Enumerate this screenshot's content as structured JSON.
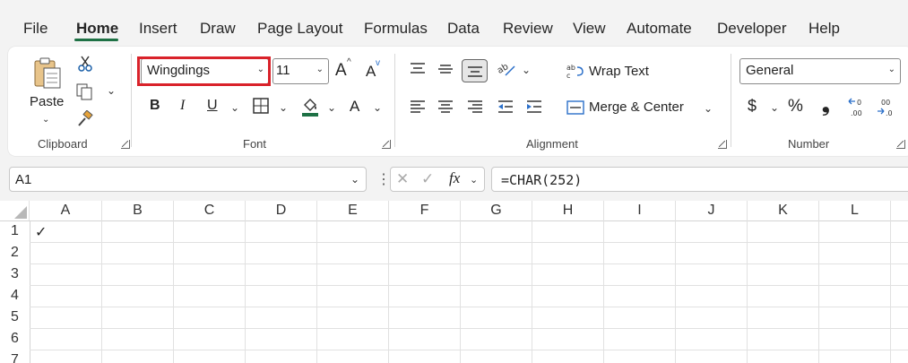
{
  "menu": {
    "tabs": [
      "File",
      "Home",
      "Insert",
      "Draw",
      "Page Layout",
      "Formulas",
      "Data",
      "Review",
      "View",
      "Automate",
      "Developer",
      "Help"
    ],
    "active": "Home"
  },
  "ribbon": {
    "clipboard": {
      "paste_label": "Paste",
      "group_label": "Clipboard"
    },
    "font": {
      "font_name": "Wingdings",
      "font_size": "11",
      "group_label": "Font",
      "grow_label": "A",
      "shrink_label": "A",
      "bold": "B",
      "italic": "I",
      "underline": "U",
      "color_label": "A"
    },
    "alignment": {
      "wrap_text": "Wrap Text",
      "merge_center": "Merge & Center",
      "group_label": "Alignment"
    },
    "number": {
      "format": "General",
      "group_label": "Number",
      "currency": "$",
      "percent": "%",
      "comma": "❟",
      "inc_decimal": ".00",
      "dec_decimal": ".0"
    }
  },
  "formula_bar": {
    "name_box": "A1",
    "fx": "fx",
    "formula": "=CHAR(252)"
  },
  "sheet": {
    "columns": [
      "A",
      "B",
      "C",
      "D",
      "E",
      "F",
      "G",
      "H",
      "I",
      "J",
      "K",
      "L"
    ],
    "rows": [
      "1",
      "2",
      "3",
      "4",
      "5",
      "6",
      "7"
    ],
    "cells": {
      "A1": "✓"
    }
  },
  "colors": {
    "accent": "#1e7145",
    "highlight_border": "#d9222a",
    "fill_color": "#1e7145"
  }
}
